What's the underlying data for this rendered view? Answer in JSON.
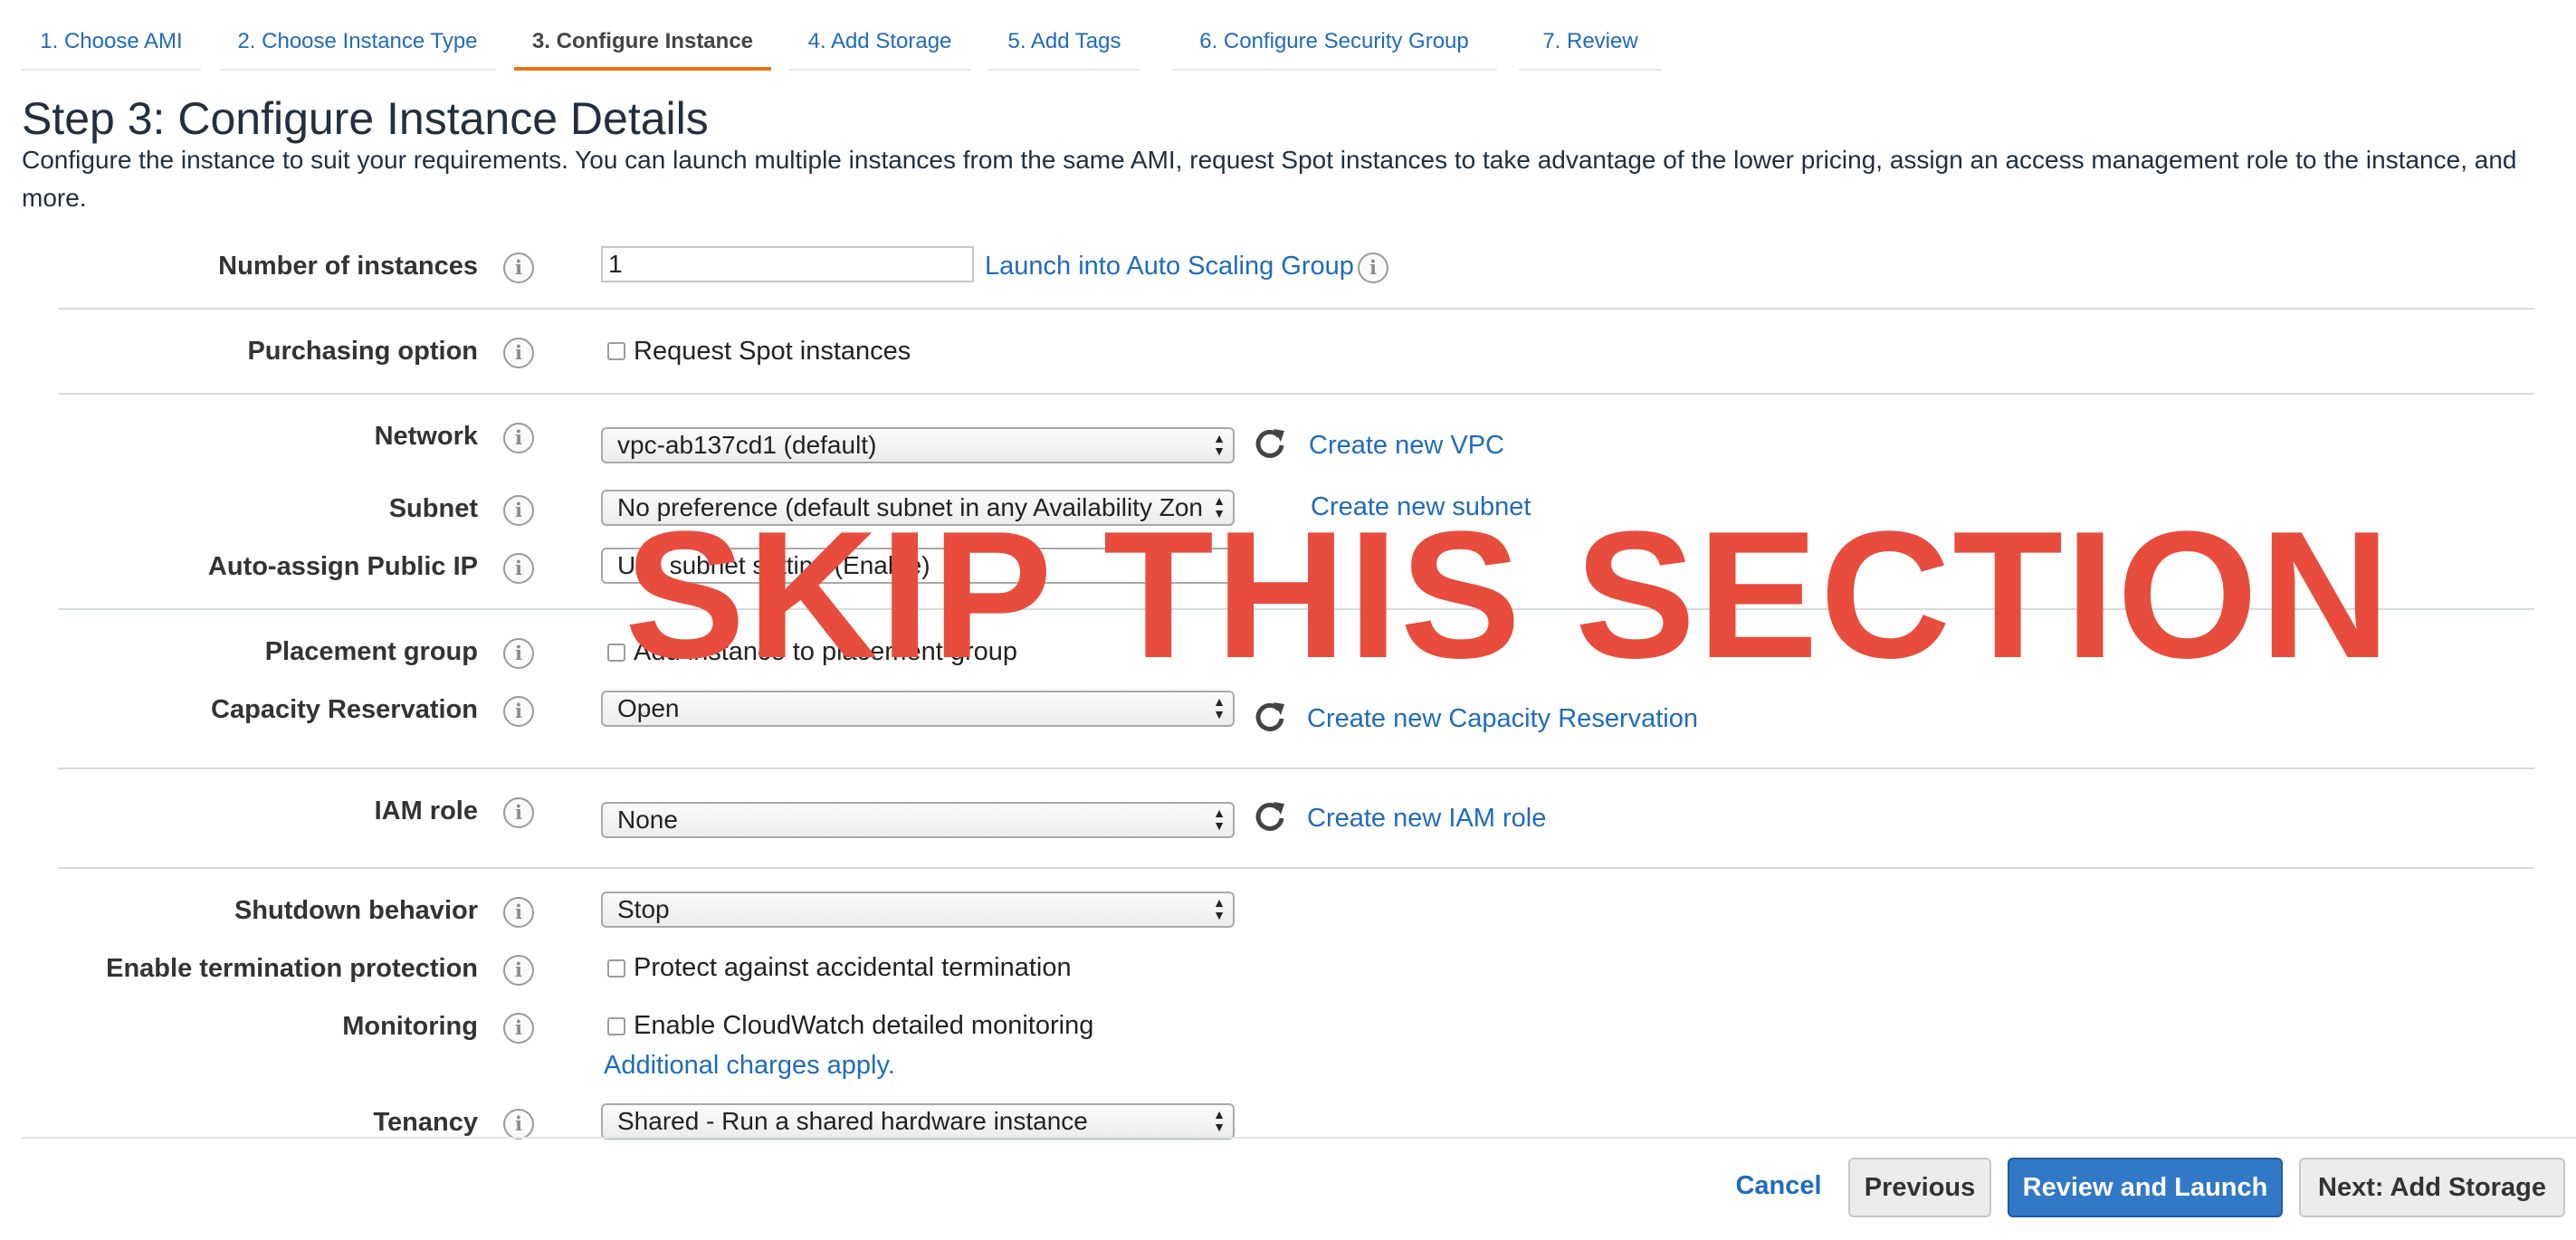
{
  "tabs": [
    {
      "label": "1. Choose AMI"
    },
    {
      "label": "2. Choose Instance Type"
    },
    {
      "label": "3. Configure Instance",
      "active": true
    },
    {
      "label": "4. Add Storage"
    },
    {
      "label": "5. Add Tags"
    },
    {
      "label": "6. Configure Security Group"
    },
    {
      "label": "7. Review"
    }
  ],
  "page": {
    "title": "Step 3: Configure Instance Details",
    "description": "Configure the instance to suit your requirements. You can launch multiple instances from the same AMI, request Spot instances to take advantage of the lower pricing, assign an access management role to the instance, and more."
  },
  "form": {
    "number_of_instances": {
      "label": "Number of instances",
      "value": "1",
      "link": "Launch into Auto Scaling Group"
    },
    "purchasing_option": {
      "label": "Purchasing option",
      "checkbox": "Request Spot instances"
    },
    "network": {
      "label": "Network",
      "value": "vpc-ab137cd1 (default)",
      "link": "Create new VPC"
    },
    "subnet": {
      "label": "Subnet",
      "value": "No preference (default subnet in any Availability Zon",
      "link": "Create new subnet"
    },
    "auto_assign_ip": {
      "label": "Auto-assign Public IP",
      "value": "Use subnet setting (Enable)"
    },
    "placement_group": {
      "label": "Placement group",
      "checkbox": "Add instance to placement group"
    },
    "capacity_reservation": {
      "label": "Capacity Reservation",
      "value": "Open",
      "link": "Create new Capacity Reservation"
    },
    "iam_role": {
      "label": "IAM role",
      "value": "None",
      "link": "Create new IAM role"
    },
    "shutdown_behavior": {
      "label": "Shutdown behavior",
      "value": "Stop"
    },
    "termination_protection": {
      "label": "Enable termination protection",
      "checkbox": "Protect against accidental termination"
    },
    "monitoring": {
      "label": "Monitoring",
      "checkbox": "Enable CloudWatch detailed monitoring",
      "link": "Additional charges apply."
    },
    "tenancy": {
      "label": "Tenancy",
      "value": "Shared - Run a shared hardware instance"
    }
  },
  "overlay": {
    "text": "SKIP THIS SECTION",
    "color": "#e84c3d"
  },
  "footer": {
    "cancel": "Cancel",
    "previous": "Previous",
    "review_launch": "Review and Launch",
    "next": "Next: Add Storage"
  },
  "icons": {
    "info": "info-icon",
    "refresh": "refresh-icon",
    "select_arrows": "select-arrows-icon"
  },
  "colors": {
    "link": "#1f6bbd",
    "active_tab": "#ec7211",
    "primary_button": "#3178c6"
  }
}
